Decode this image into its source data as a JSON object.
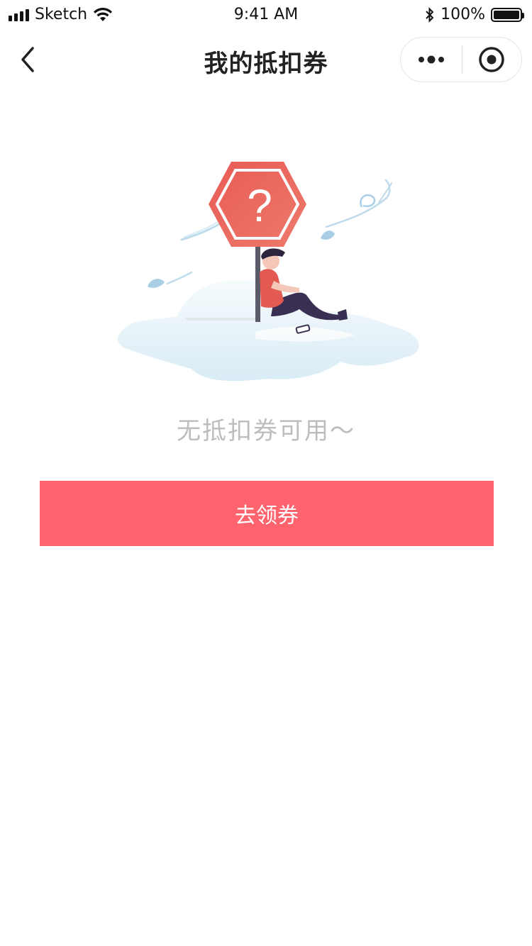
{
  "status_bar": {
    "carrier": "Sketch",
    "time": "9:41 AM",
    "battery": "100%"
  },
  "nav": {
    "title": "我的抵扣券"
  },
  "empty_state": {
    "message": "无抵扣券可用～",
    "sign_symbol": "?"
  },
  "actions": {
    "get_coupon_label": "去领券"
  },
  "colors": {
    "accent": "#ff636e",
    "sign_red": "#e8615c",
    "muted_text": "#bdbdbd",
    "cloud": "#e3f0f7"
  }
}
